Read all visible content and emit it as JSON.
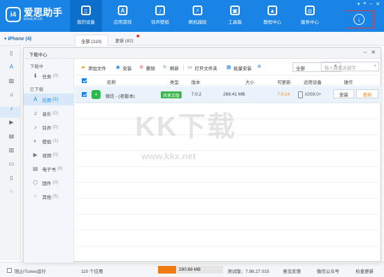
{
  "app": {
    "logo_badge": "i4",
    "logo_name": "爱思助手",
    "logo_url": "www.i4.cn"
  },
  "nav": [
    {
      "label": "我的设备",
      "icon": "phone-icon"
    },
    {
      "label": "应用游戏",
      "icon": "apps-icon"
    },
    {
      "label": "铃声壁纸",
      "icon": "wallpaper-icon"
    },
    {
      "label": "刷机越狱",
      "icon": "flash-icon"
    },
    {
      "label": "工具箱",
      "icon": "toolbox-icon"
    },
    {
      "label": "教程中心",
      "icon": "tutorial-icon"
    },
    {
      "label": "服务中心",
      "icon": "service-icon"
    }
  ],
  "device": {
    "name": "iPhone (4)"
  },
  "tabs": {
    "all": "全部 (110)",
    "update": "更新 (82)"
  },
  "dialog": {
    "title": "下载中心",
    "sections": {
      "downloading": "下载中",
      "downloaded": "已下载"
    },
    "task": {
      "label": "任务",
      "count": "(0)"
    },
    "categories": [
      {
        "label": "应用",
        "count": "(1)",
        "icon": "apps-icon"
      },
      {
        "label": "音乐",
        "count": "(0)",
        "icon": "music-icon"
      },
      {
        "label": "铃声",
        "count": "(0)",
        "icon": "bell-icon"
      },
      {
        "label": "壁纸",
        "count": "(1)",
        "icon": "wallpaper-icon"
      },
      {
        "label": "视频",
        "count": "(0)",
        "icon": "video-icon"
      },
      {
        "label": "电子书",
        "count": "(0)",
        "icon": "ebook-icon"
      },
      {
        "label": "固件",
        "count": "(0)",
        "icon": "firmware-icon"
      },
      {
        "label": "其他",
        "count": "(5)",
        "icon": "other-icon"
      }
    ],
    "toolbar": {
      "add_file": "添加文件",
      "install": "安装",
      "delete": "删除",
      "refresh": "刷新",
      "open_folder": "打开文件夹",
      "batch_install": "批量安装",
      "filter": "全部",
      "search_placeholder": "输入搜索关键字"
    },
    "columns": {
      "name": "名称",
      "type": "类型",
      "version": "版本",
      "size": "大小",
      "updatable": "可更新",
      "compat": "适用设备",
      "action": "操作"
    },
    "row": {
      "name": "微信 - (老版本)",
      "type": "共享正版",
      "version": "7.0.2",
      "size": "269.41 MB",
      "updatable": "7.0.14",
      "compat": "iOS9.0+",
      "install": "安装",
      "update": "更新"
    }
  },
  "status": {
    "itunes": "阻止iTunes运行",
    "app_count": "110 个应用",
    "storage": "290.68 MB",
    "storage_fill": 0.28,
    "version": "测试版：7.98.27.015",
    "feedback": "意见反馈",
    "wechat": "微信公众号",
    "check_update": "检查更新"
  },
  "watermark": {
    "text": "KK下载",
    "url": "www.kkx.net"
  },
  "colors": {
    "accent": "#1a84e6",
    "orange": "#f27a12",
    "green": "#3ab54a"
  }
}
